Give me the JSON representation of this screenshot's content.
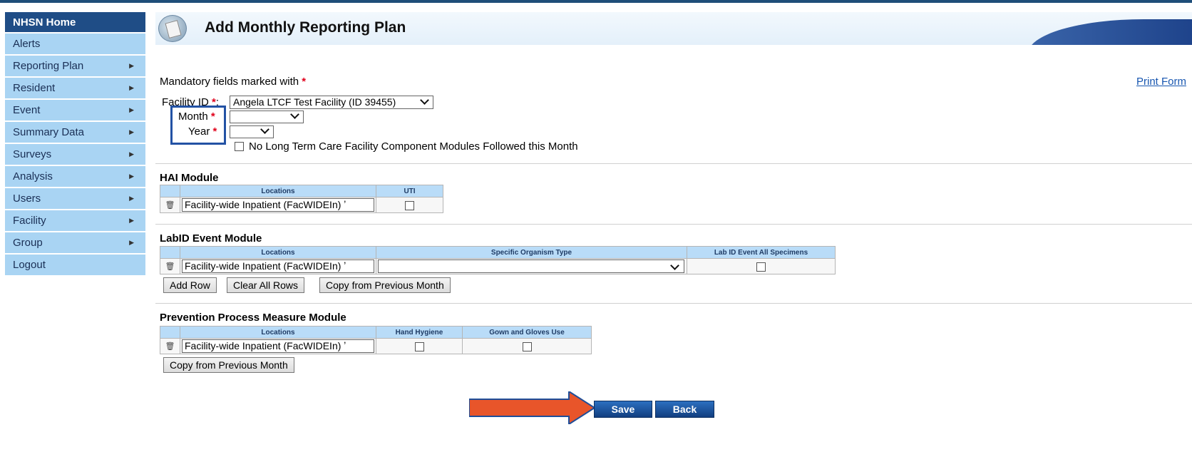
{
  "sidebar": {
    "items": [
      {
        "label": "NHSN Home",
        "arrow": false
      },
      {
        "label": "Alerts",
        "arrow": false
      },
      {
        "label": "Reporting Plan",
        "arrow": true
      },
      {
        "label": "Resident",
        "arrow": true
      },
      {
        "label": "Event",
        "arrow": true
      },
      {
        "label": "Summary Data",
        "arrow": true
      },
      {
        "label": "Surveys",
        "arrow": true
      },
      {
        "label": "Analysis",
        "arrow": true
      },
      {
        "label": "Users",
        "arrow": true
      },
      {
        "label": "Facility",
        "arrow": true
      },
      {
        "label": "Group",
        "arrow": true
      },
      {
        "label": "Logout",
        "arrow": false
      }
    ]
  },
  "header": {
    "title": "Add Monthly Reporting Plan"
  },
  "form": {
    "mandatory_text": "Mandatory fields marked with",
    "star": "*",
    "print_form": "Print Form",
    "facility_label": "Facility ID",
    "facility_value": "Angela LTCF Test Facility (ID 39455)",
    "month_label": "Month",
    "month_value": "",
    "year_label": "Year",
    "year_value": "",
    "no_modules_label": "No Long Term Care Facility Component Modules Followed this Month"
  },
  "hai": {
    "title": "HAI Module",
    "col_locations": "Locations",
    "col_uti": "UTI",
    "location_value": "Facility-wide Inpatient (FacWIDEIn) ʼ"
  },
  "labid": {
    "title": "LabID Event Module",
    "col_locations": "Locations",
    "col_organism": "Specific Organism Type",
    "col_all_specimens": "Lab ID Event All Specimens",
    "location_value": "Facility-wide Inpatient (FacWIDEIn) ʼ",
    "add_row": "Add Row",
    "clear_rows": "Clear All Rows",
    "copy_prev": "Copy from Previous Month"
  },
  "ppm": {
    "title": "Prevention Process Measure Module",
    "col_locations": "Locations",
    "col_hand": "Hand Hygiene",
    "col_gown": "Gown and Gloves Use",
    "location_value": "Facility-wide Inpatient (FacWIDEIn) ʼ",
    "copy_prev": "Copy from Previous Month"
  },
  "actions": {
    "save": "Save",
    "back": "Back"
  },
  "colors": {
    "nav_bg": "#a9d4f3",
    "home_bg": "#1f4d86",
    "button_blue": "#1f5aa6",
    "arrow": "#e8552a",
    "highlight": "#2352a4"
  }
}
